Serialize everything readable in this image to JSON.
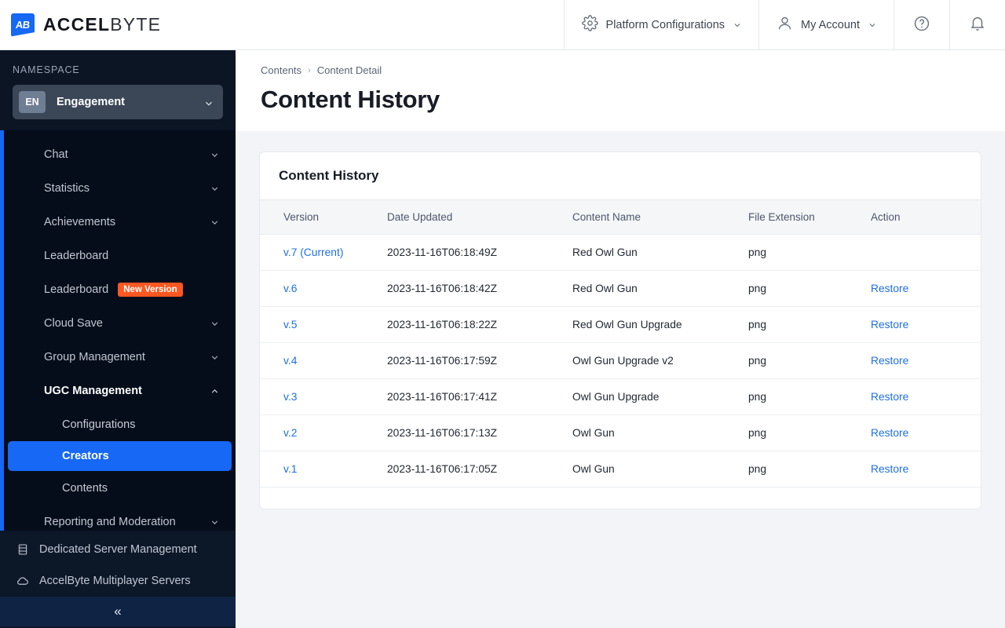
{
  "brand": {
    "logo_bold": "ACCEL",
    "logo_light": "BYTE",
    "logo_mark_text": "AB"
  },
  "topbar": {
    "platform_configurations": "Platform Configurations",
    "my_account": "My Account",
    "help_icon": "help-circle-icon",
    "notification_icon": "bell-icon",
    "gear_icon": "gear-icon",
    "user_icon": "user-icon"
  },
  "sidebar": {
    "namespace_label": "NAMESPACE",
    "namespace_badge": "EN",
    "namespace_value": "Engagement",
    "items": [
      {
        "label": "Chat",
        "expandable": true,
        "level": 0
      },
      {
        "label": "Statistics",
        "expandable": true,
        "level": 0
      },
      {
        "label": "Achievements",
        "expandable": true,
        "level": 0
      },
      {
        "label": "Leaderboard",
        "expandable": false,
        "level": 0
      },
      {
        "label": "Leaderboard",
        "expandable": false,
        "level": 0,
        "badge": "New Version"
      },
      {
        "label": "Cloud Save",
        "expandable": true,
        "level": 0
      },
      {
        "label": "Group Management",
        "expandable": true,
        "level": 0
      },
      {
        "label": "UGC Management",
        "expandable": true,
        "expanded": true,
        "level": 0
      },
      {
        "label": "Configurations",
        "expandable": false,
        "level": 1
      },
      {
        "label": "Creators",
        "expandable": false,
        "level": 1,
        "active": true
      },
      {
        "label": "Contents",
        "expandable": false,
        "level": 1
      },
      {
        "label": "Reporting and Moderation",
        "expandable": true,
        "level": 0
      }
    ],
    "bottom_items": [
      {
        "label": "Dedicated Server Management",
        "icon": "server-icon"
      },
      {
        "label": "AccelByte Multiplayer Servers",
        "icon": "cloud-icon"
      }
    ],
    "collapse_label": "«"
  },
  "main": {
    "breadcrumb": [
      "Contents",
      "Content Detail"
    ],
    "breadcrumb_separator": "›",
    "page_title": "Content History",
    "card_title": "Content History",
    "table": {
      "columns": [
        "Version",
        "Date Updated",
        "Content Name",
        "File Extension",
        "Action"
      ],
      "rows": [
        {
          "version": "v.7 (Current)",
          "date": "2023-11-16T06:18:49Z",
          "name": "Red Owl Gun",
          "ext": "png",
          "action": ""
        },
        {
          "version": "v.6",
          "date": "2023-11-16T06:18:42Z",
          "name": "Red Owl Gun",
          "ext": "png",
          "action": "Restore"
        },
        {
          "version": "v.5",
          "date": "2023-11-16T06:18:22Z",
          "name": "Red Owl Gun Upgrade",
          "ext": "png",
          "action": "Restore"
        },
        {
          "version": "v.4",
          "date": "2023-11-16T06:17:59Z",
          "name": "Owl Gun Upgrade v2",
          "ext": "png",
          "action": "Restore"
        },
        {
          "version": "v.3",
          "date": "2023-11-16T06:17:41Z",
          "name": "Owl Gun Upgrade",
          "ext": "png",
          "action": "Restore"
        },
        {
          "version": "v.2",
          "date": "2023-11-16T06:17:13Z",
          "name": "Owl Gun",
          "ext": "png",
          "action": "Restore"
        },
        {
          "version": "v.1",
          "date": "2023-11-16T06:17:05Z",
          "name": "Owl Gun",
          "ext": "png",
          "action": "Restore"
        }
      ]
    }
  },
  "colors": {
    "accent_blue": "#1668f5",
    "link_blue": "#1f6fe5",
    "badge_orange": "#ff5722",
    "sidebar_dark": "#0d1626",
    "nav_dark": "#050d1a"
  }
}
